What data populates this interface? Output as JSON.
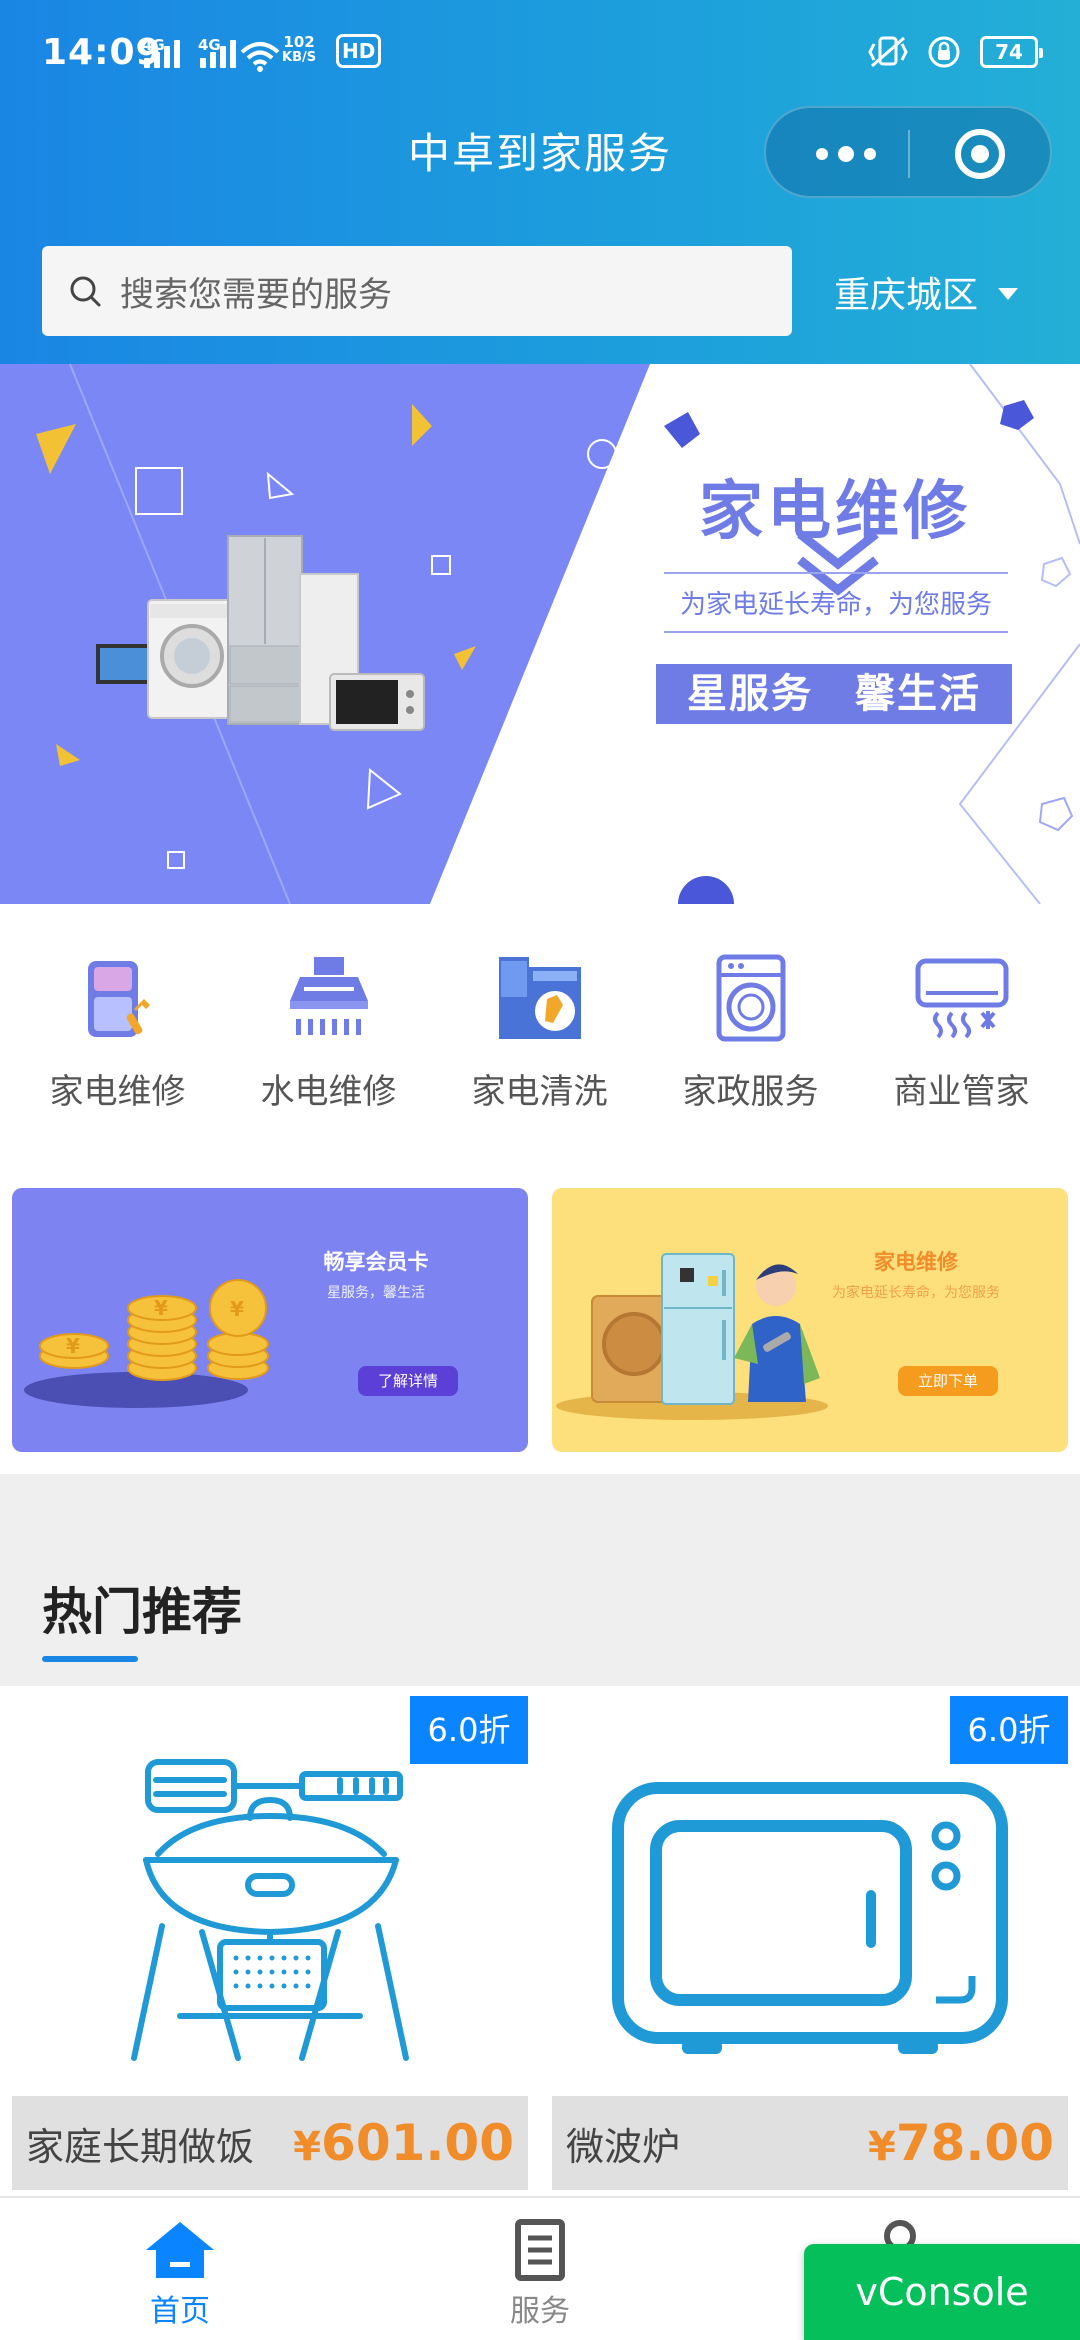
{
  "status_bar": {
    "time": "14:09",
    "signal1": "4G",
    "signal2": "4G",
    "speed_value": "102",
    "speed_unit": "KB/S",
    "hd": "HD",
    "battery": "74"
  },
  "header": {
    "title": "中卓到家服务",
    "search_placeholder": "搜索您需要的服务",
    "city": "重庆城区"
  },
  "banner": {
    "title": "家电维修",
    "subtitle": "为家电延长寿命，为您服务",
    "tagline": "星服务　馨生活"
  },
  "categories": [
    {
      "label": "家电维修",
      "icon": "fridge-repair-icon"
    },
    {
      "label": "水电维修",
      "icon": "range-hood-icon"
    },
    {
      "label": "家电清洗",
      "icon": "cleaning-icon"
    },
    {
      "label": "家政服务",
      "icon": "washing-machine-icon"
    },
    {
      "label": "商业管家",
      "icon": "air-conditioner-icon"
    }
  ],
  "promos": [
    {
      "title": "畅享会员卡",
      "subtitle": "星服务，馨生活",
      "button": "了解详情"
    },
    {
      "title": "家电维修",
      "subtitle": "为家电延长寿命，为您服务",
      "button": "立即下单"
    }
  ],
  "hot": {
    "title": "热门推荐",
    "products": [
      {
        "name": "家庭长期做饭",
        "currency": "¥",
        "price": "601.00",
        "discount": "6.0折",
        "icon": "grill-icon"
      },
      {
        "name": "微波炉",
        "currency": "¥",
        "price": "78.00",
        "discount": "6.0折",
        "icon": "microwave-icon"
      }
    ]
  },
  "tabbar": {
    "home": "首页",
    "service": "服务",
    "mine": ""
  },
  "vconsole": "vConsole",
  "colors": {
    "header_start": "#1a86e4",
    "header_end": "#23afd6",
    "banner_purple": "#6f7ce6",
    "accent_blue": "#0a84ff",
    "price_orange": "#f08c2a",
    "vconsole_green": "#05c05a"
  }
}
